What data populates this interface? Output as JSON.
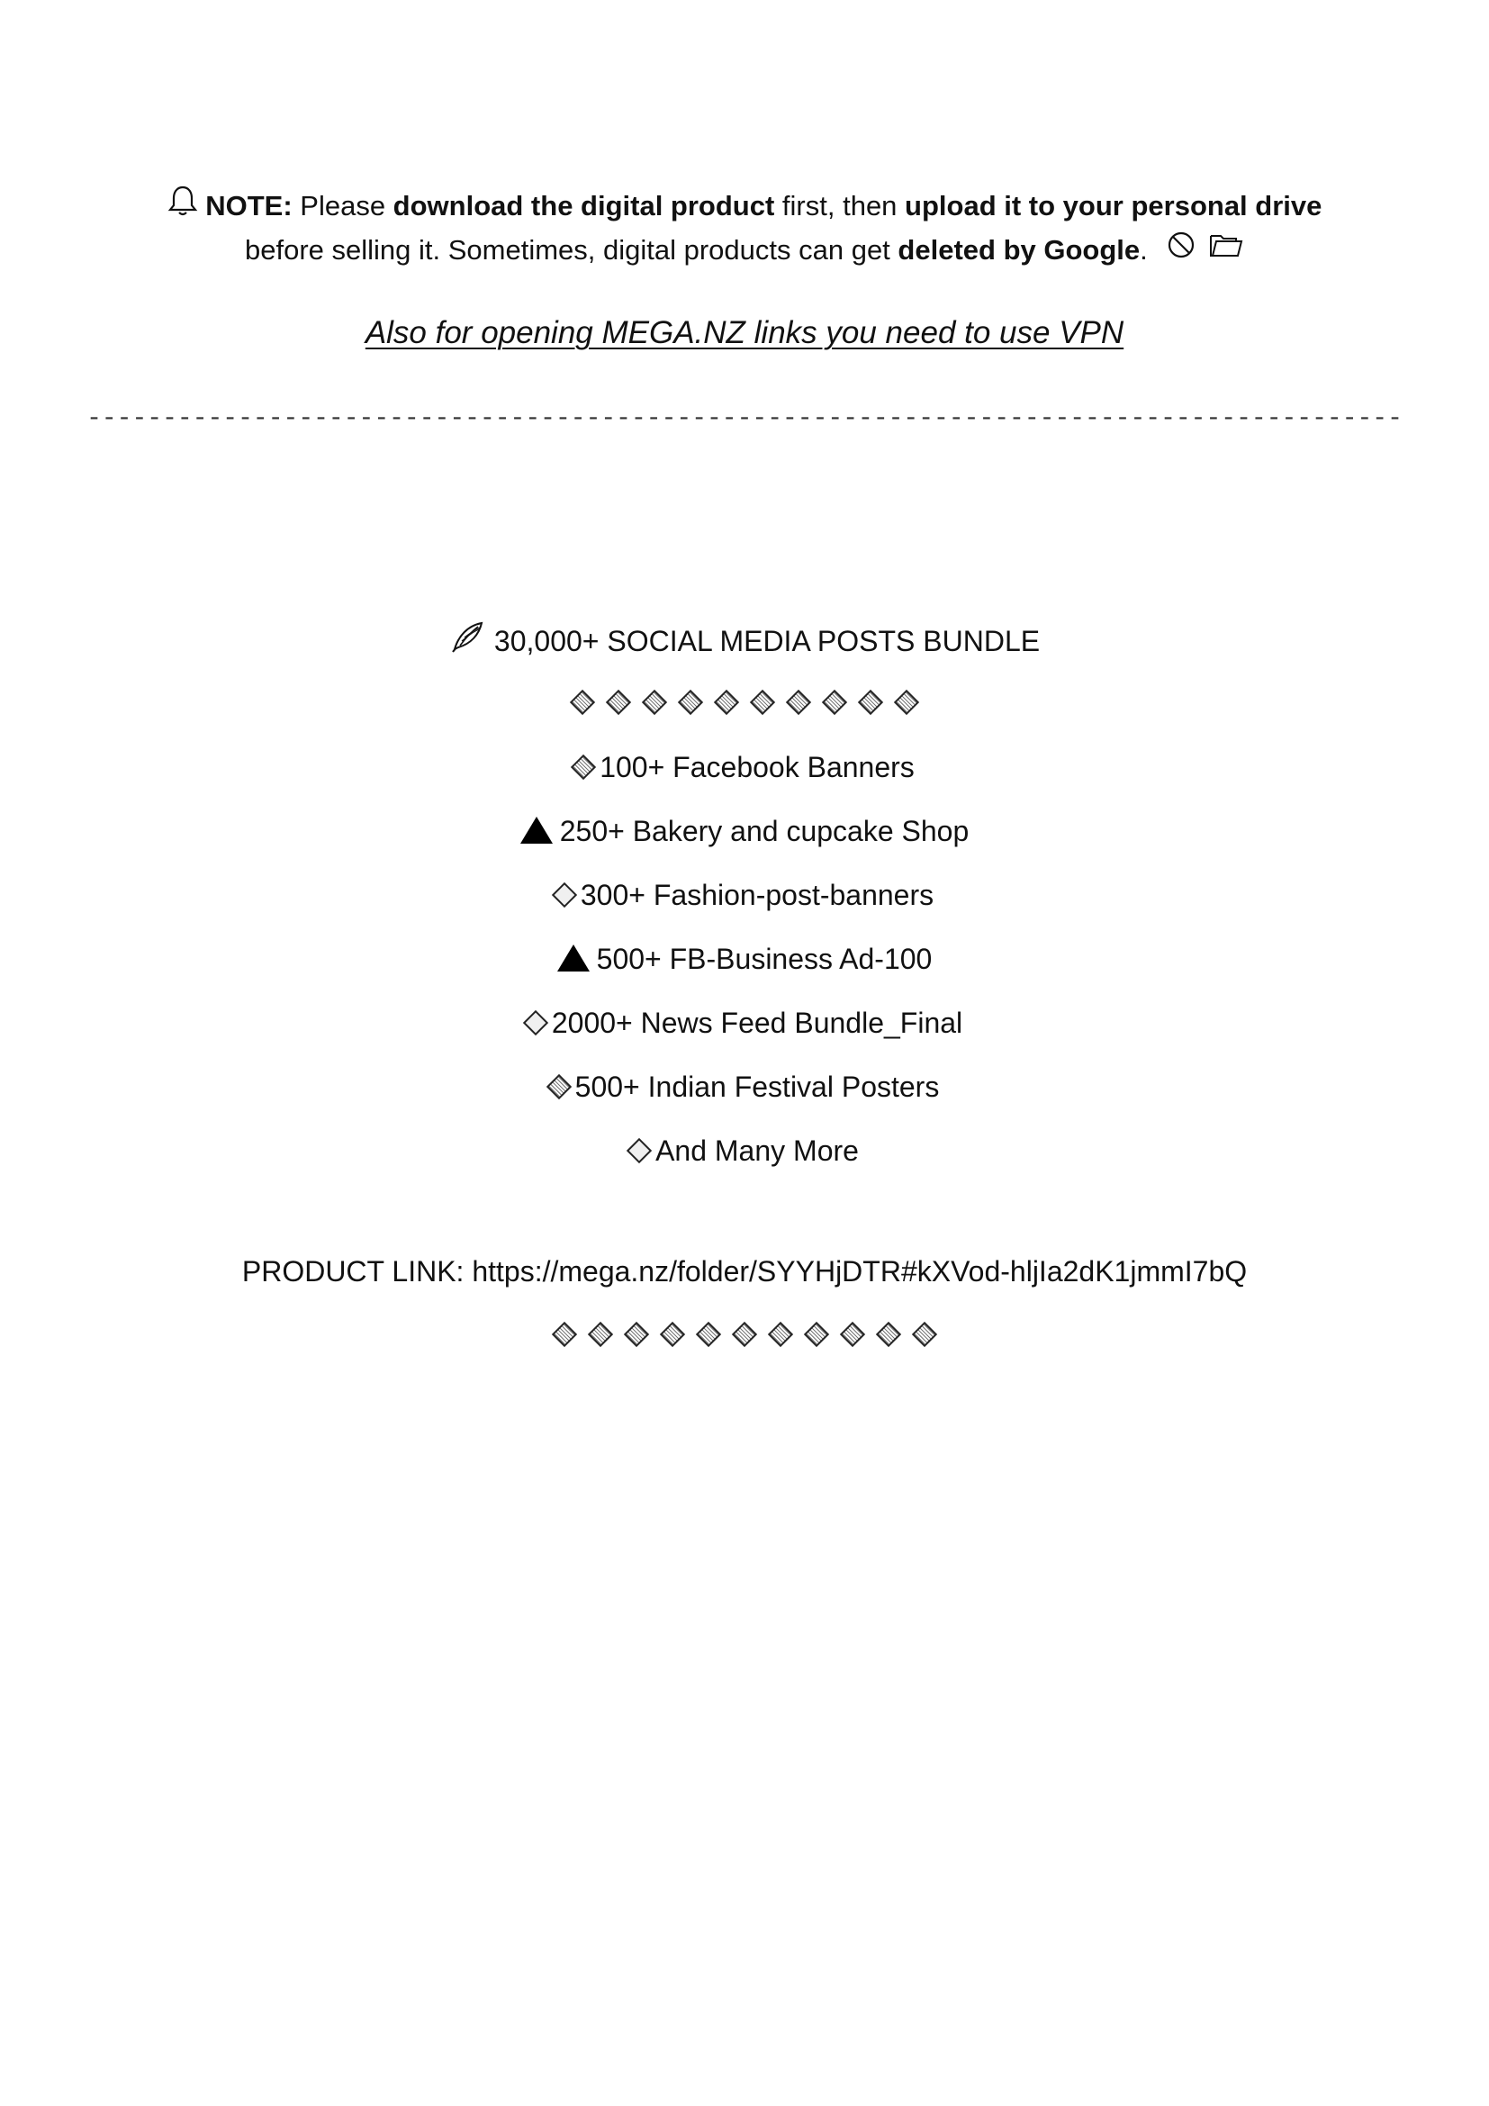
{
  "note": {
    "icon_left": "bell-icon",
    "label": "NOTE:",
    "t1": " Please ",
    "b1": "download the digital product",
    "t2": " first, then ",
    "b2": "upload it to your personal drive",
    "line2_t1": "before selling it. Sometimes, digital products can get ",
    "line2_b1": "deleted by Google",
    "line2_t2": ".",
    "icons_right": [
      "prohibited-icon",
      "folder-icon"
    ]
  },
  "vpn_text": "Also for opening MEGA.NZ links you need to use VPN",
  "divider": "---------------------------------------------------------------------------------------",
  "bundle": {
    "icon": "feather-pen-icon",
    "title": "30,000+ SOCIAL MEDIA POSTS BUNDLE",
    "top_diamond_count": 10,
    "items": [
      {
        "icon": "shaded-diamond-icon",
        "text": "100+ Facebook Banners"
      },
      {
        "icon": "black-triangle-icon",
        "text": "250+ Bakery and cupcake Shop"
      },
      {
        "icon": "diamond-icon",
        "text": "300+ Fashion-post-banners"
      },
      {
        "icon": "black-triangle-icon",
        "text": "500+ FB-Business Ad-100"
      },
      {
        "icon": "diamond-icon",
        "text": "2000+ News Feed Bundle_Final"
      },
      {
        "icon": "shaded-diamond-icon",
        "text": "500+ Indian Festival Posters"
      },
      {
        "icon": "diamond-icon",
        "text": "And Many More"
      }
    ]
  },
  "product_link": {
    "label": "PRODUCT LINK: ",
    "url": "https://mega.nz/folder/SYYHjDTR#kXVod-hljIa2dK1jmmI7bQ"
  },
  "bottom_diamond_count": 11
}
